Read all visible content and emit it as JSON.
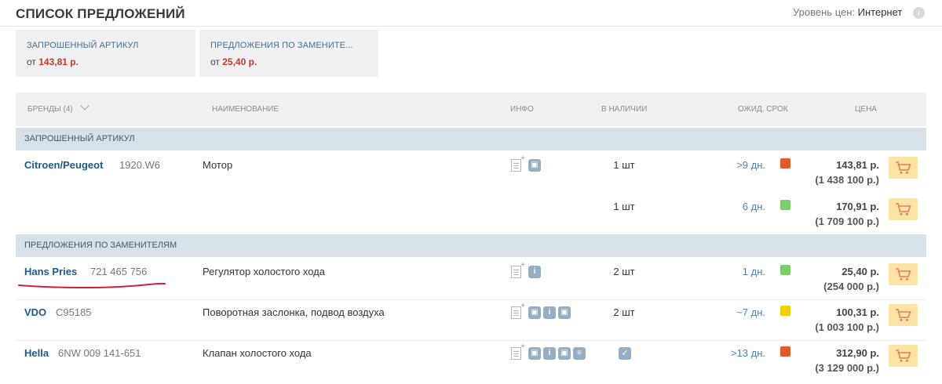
{
  "header": {
    "title": "СПИСОК ПРЕДЛОЖЕНИЙ",
    "price_level_label": "Уровень цен:",
    "price_level_value": "Интернет",
    "info_glyph": "i"
  },
  "summary": {
    "requested": {
      "label": "ЗАПРОШЕННЫЙ АРТИКУЛ",
      "from": "от",
      "price": "143,81 р."
    },
    "replacements": {
      "label": "ПРЕДЛОЖЕНИЯ ПО ЗАМЕНИТЕ...",
      "from": "от",
      "price": "25,40 р."
    }
  },
  "table": {
    "columns": {
      "brands": "БРЕНДЫ (4)",
      "name": "НАИМЕНОВАНИЕ",
      "info": "ИНФО",
      "stock": "В НАЛИЧИИ",
      "lead_time": "ОЖИД. СРОК",
      "price": "ЦЕНА"
    },
    "sections": {
      "requested": "ЗАПРОШЕННЫЙ АРТИКУЛ",
      "replacements": "ПРЕДЛОЖЕНИЯ ПО ЗАМЕНИТЕЛЯМ"
    },
    "rows": [
      {
        "brand": "Citroen/Peugeot",
        "article": "1920.W6",
        "name": "Мотор",
        "qty": "1 шт",
        "lead": ">9 дн.",
        "status": "red",
        "price": "143,81 р.",
        "price_sub": "(1 438 100 р.)"
      },
      {
        "brand": "",
        "article": "",
        "name": "",
        "qty": "1 шт",
        "lead": "6 дн.",
        "status": "green",
        "price": "170,91 р.",
        "price_sub": "(1 709 100 р.)"
      },
      {
        "brand": "Hans Pries",
        "article": "721 465 756",
        "name": "Регулятор холостого хода",
        "qty": "2 шт",
        "lead": "1 дн.",
        "status": "green",
        "price": "25,40 р.",
        "price_sub": "(254 000 р.)"
      },
      {
        "brand": "VDO",
        "article": "C95185",
        "name": "Поворотная заслонка, подвод воздуха",
        "qty": "2 шт",
        "lead": "~7 дн.",
        "status": "yellow",
        "price": "100,31 р.",
        "price_sub": "(1 003 100 р.)"
      },
      {
        "brand": "Hella",
        "article": "6NW 009 141-651",
        "name": "Клапан холостого хода",
        "qty": "",
        "lead": ">13 дн.",
        "status": "red",
        "price": "312,90 р.",
        "price_sub": "(3 129 000 р.)"
      }
    ]
  },
  "icons": {
    "info_icon": "i",
    "check_icon": "✓"
  },
  "colors": {
    "red": "#e05a2b",
    "green": "#7dcb6a",
    "yellow": "#f0d000",
    "brand_blue": "#1e5a85",
    "cart_bg": "#fde4a4",
    "cart_icon": "#e87a6a",
    "annotation": "#d02040"
  }
}
